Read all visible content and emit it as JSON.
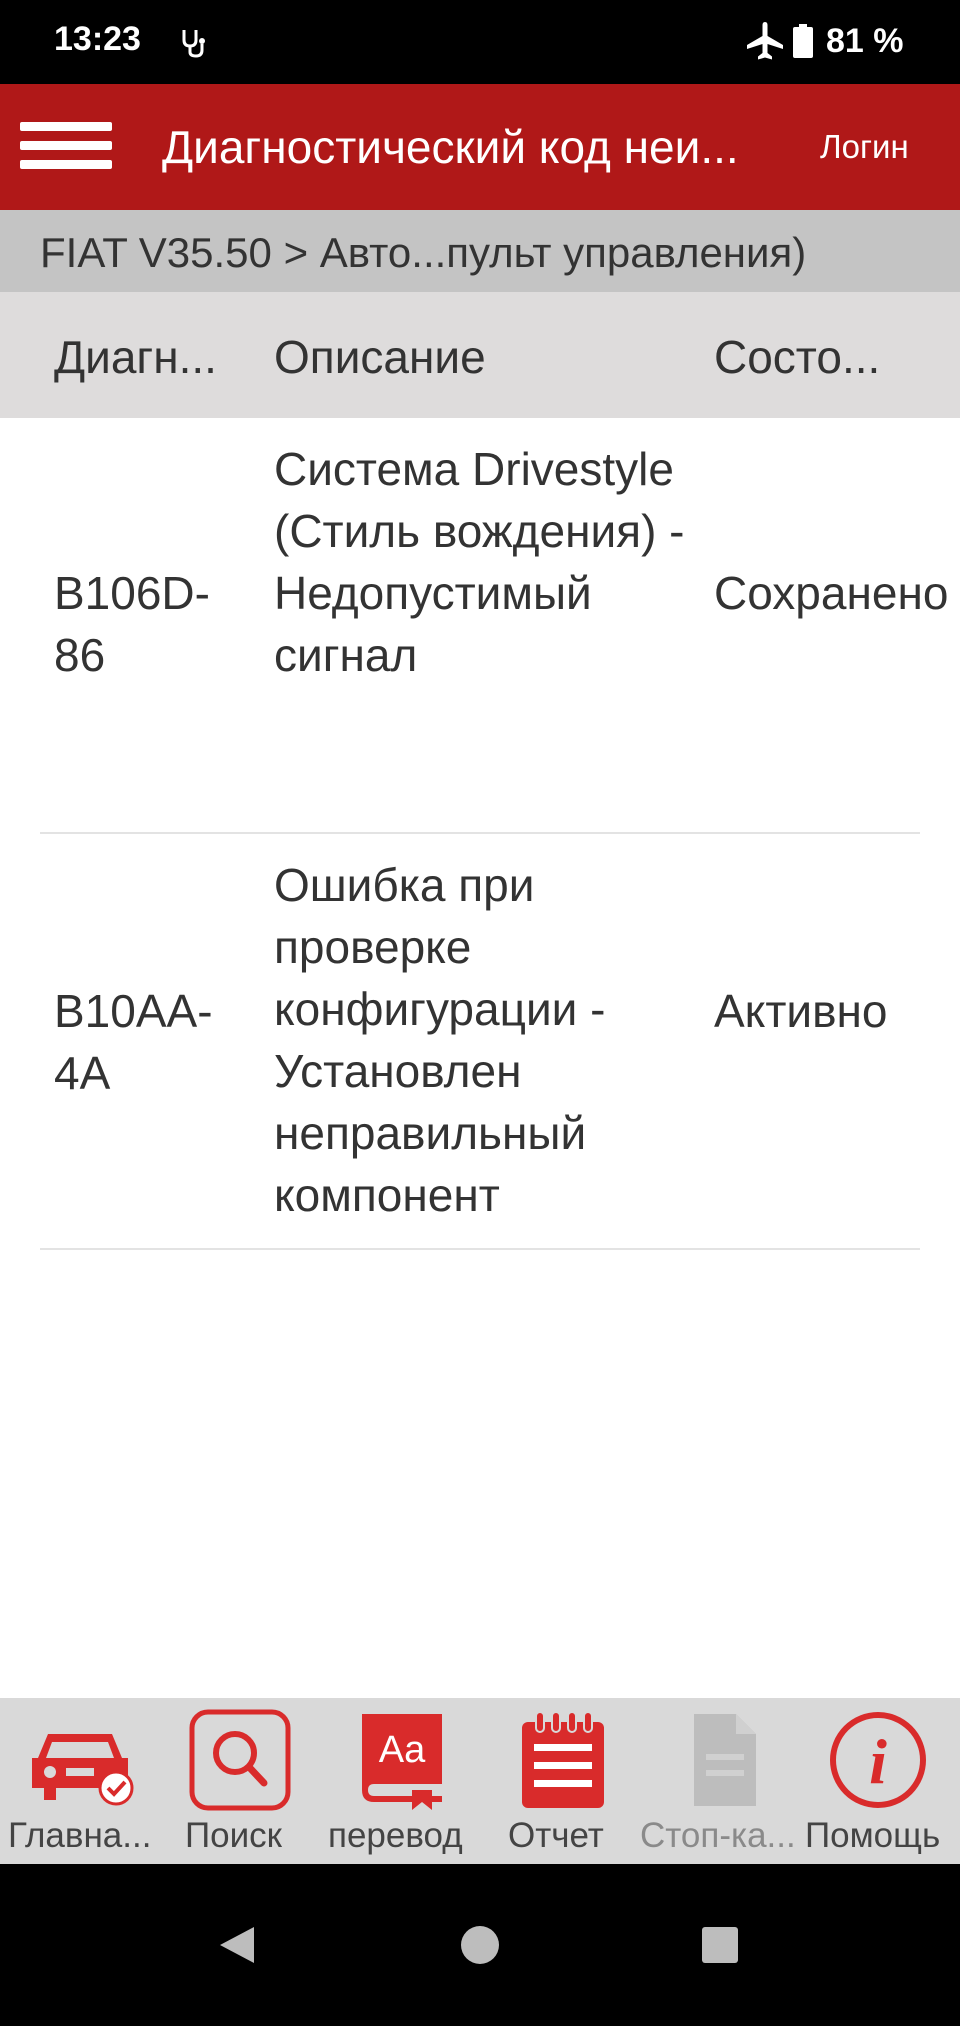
{
  "status_bar": {
    "time": "13:23",
    "battery": "81 %"
  },
  "app_bar": {
    "title": "Диагностический код неи...",
    "login": "Логин"
  },
  "breadcrumb": "FIAT V35.50 > Авто...пульт управления)",
  "table": {
    "headers": [
      "Диагн...",
      "Описание",
      "Состо..."
    ],
    "rows": [
      {
        "code": "B106D-86",
        "description": "Система Drivestyle (Стиль вождения) - Недопустимый сигнал",
        "state": "Сохранено"
      },
      {
        "code": "B10AA-4A",
        "description": "Ошибка при проверке конфигурации - Установлен неправильный компонент",
        "state": "Активно"
      }
    ]
  },
  "toolbar": [
    {
      "label": "Главна...",
      "icon": "car-check-icon"
    },
    {
      "label": "Поиск",
      "icon": "search-icon"
    },
    {
      "label": "перевод",
      "icon": "translate-icon"
    },
    {
      "label": "Отчет",
      "icon": "report-icon"
    },
    {
      "label": "Стоп-ка...",
      "icon": "freeze-frame-icon",
      "disabled": true
    },
    {
      "label": "Помощь",
      "icon": "help-icon"
    }
  ],
  "colors": {
    "brand_red": "#b01818",
    "icon_red": "#d92b2b",
    "disabled_gray": "#bdbdbd"
  }
}
